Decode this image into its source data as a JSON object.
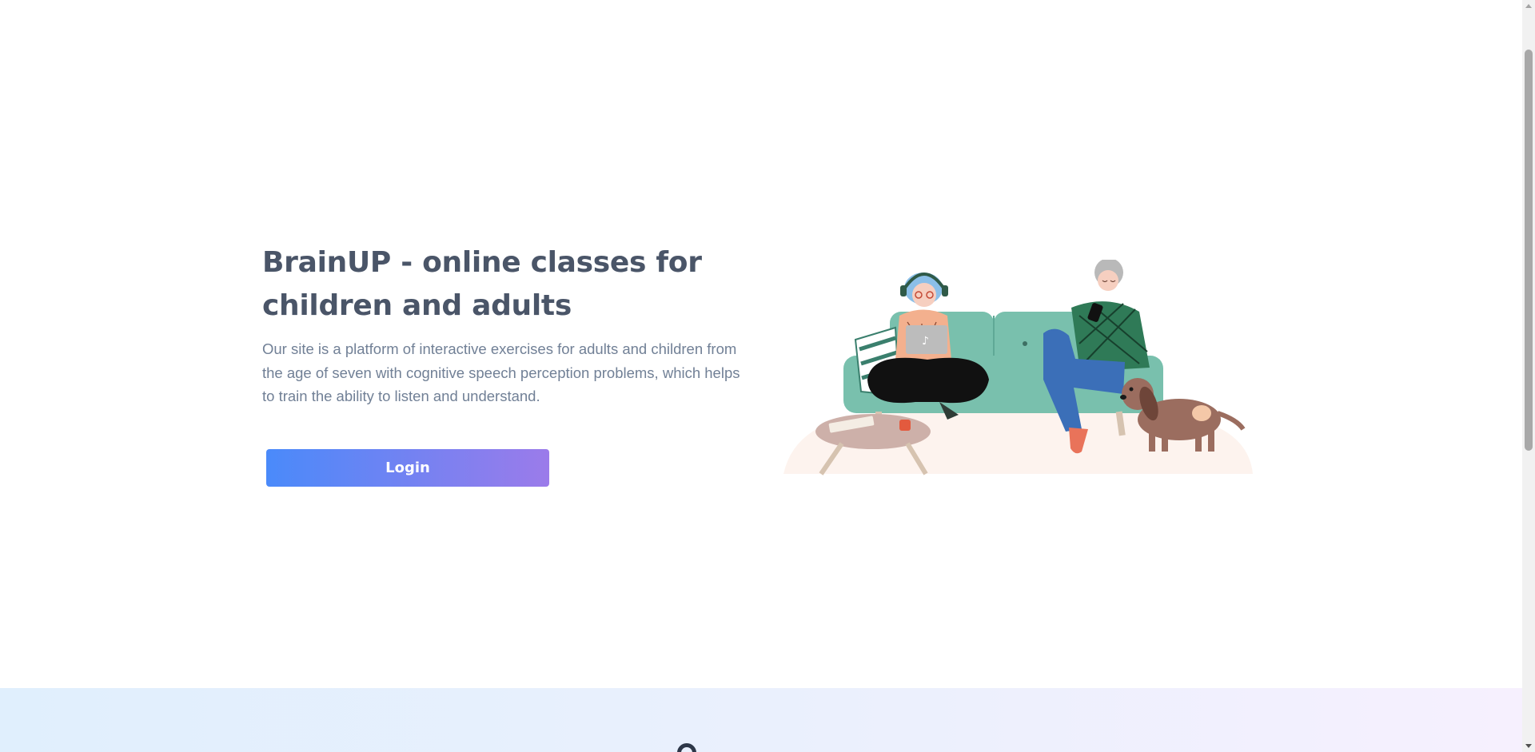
{
  "hero": {
    "title": "BrainUP - online classes for children and adults",
    "description": "Our site is a platform of interactive exercises for adults and children from the age of seven with cognitive speech perception problems, which helps to train the ability to listen and understand.",
    "login_label": "Login"
  },
  "colors": {
    "title": "#4a5568",
    "description": "#718096",
    "button_gradient_start": "#4a8afa",
    "button_gradient_end": "#9b7bea",
    "section_bg_start": "#e0effd",
    "section_bg_end": "#f6f0fe"
  },
  "illustration": {
    "subject": "woman-with-laptop-and-elderly-man-with-phone-on-sofa-with-dog-illustration"
  }
}
